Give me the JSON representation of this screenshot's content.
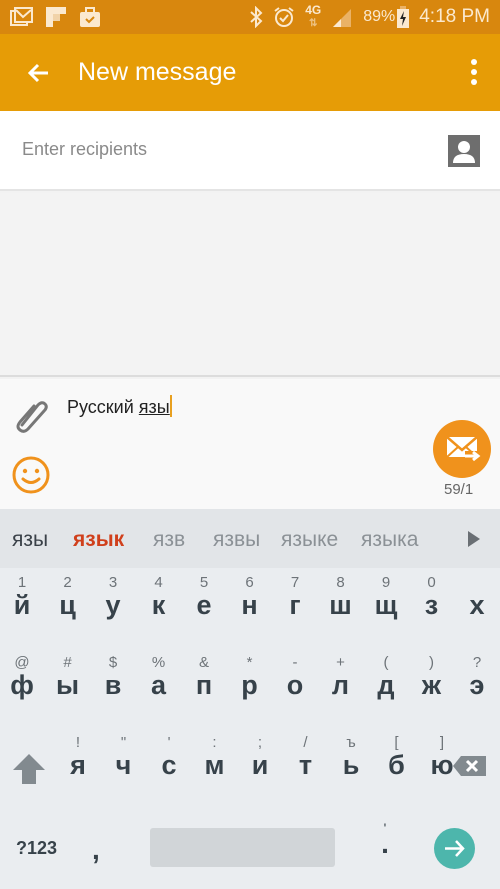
{
  "status_bar": {
    "left_icons": [
      "gmail-icon",
      "flipboard-icon",
      "briefcase-icon"
    ],
    "right_icons": [
      "bluetooth-icon",
      "alarm-icon",
      "network-4g-icon",
      "signal-icon"
    ],
    "network": "4G",
    "battery": "89%",
    "time": "4:18 PM"
  },
  "app_bar": {
    "title": "New message",
    "back_icon": "arrow-back-icon",
    "menu_icon": "more-vert-icon",
    "color": "#e69c06"
  },
  "recipients": {
    "placeholder": "Enter recipients",
    "value": ""
  },
  "compose": {
    "text_committed": "Русский ",
    "text_composing": "язы",
    "char_counter": "59/1",
    "send_color": "#f0921c"
  },
  "keyboard": {
    "suggestions": [
      "язы",
      "язык",
      "язв",
      "язвы",
      "языке",
      "языка"
    ],
    "rows": [
      [
        {
          "hint": "1",
          "key": "й"
        },
        {
          "hint": "2",
          "key": "ц"
        },
        {
          "hint": "3",
          "key": "у"
        },
        {
          "hint": "4",
          "key": "к"
        },
        {
          "hint": "5",
          "key": "е"
        },
        {
          "hint": "6",
          "key": "н"
        },
        {
          "hint": "7",
          "key": "г"
        },
        {
          "hint": "8",
          "key": "ш"
        },
        {
          "hint": "9",
          "key": "щ"
        },
        {
          "hint": "0",
          "key": "з"
        },
        {
          "hint": "",
          "key": "х"
        }
      ],
      [
        {
          "hint": "@",
          "key": "ф"
        },
        {
          "hint": "#",
          "key": "ы"
        },
        {
          "hint": "$",
          "key": "в"
        },
        {
          "hint": "%",
          "key": "а"
        },
        {
          "hint": "&",
          "key": "п"
        },
        {
          "hint": "*",
          "key": "р"
        },
        {
          "hint": "-",
          "key": "о"
        },
        {
          "hint": "+",
          "key": "л"
        },
        {
          "hint": "(",
          "key": "д"
        },
        {
          "hint": ")",
          "key": "ж"
        },
        {
          "hint": "?",
          "key": "э"
        }
      ],
      [
        {
          "hint": "!",
          "key": "я"
        },
        {
          "hint": "\"",
          "key": "ч"
        },
        {
          "hint": "'",
          "key": "с"
        },
        {
          "hint": ":",
          "key": "м"
        },
        {
          "hint": ";",
          "key": "и"
        },
        {
          "hint": "/",
          "key": "т"
        },
        {
          "hint": "ъ",
          "key": "ь"
        },
        {
          "hint": "[",
          "key": "б"
        },
        {
          "hint": "]",
          "key": "ю"
        }
      ]
    ],
    "symbols_key": "?123",
    "comma_key": ",",
    "period_key": ".",
    "period_hint": "'",
    "enter_color": "#4db6ac"
  }
}
